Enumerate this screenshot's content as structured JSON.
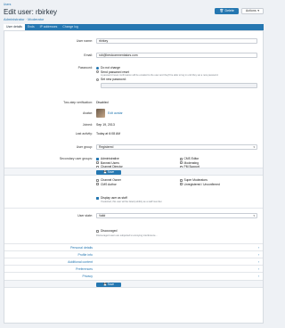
{
  "breadcrumb": "Users",
  "page_title": "Edit user: rbirkey",
  "subtitle": {
    "admin": "Administrator",
    "separator": "·",
    "mod": "Moderator"
  },
  "top_actions": {
    "delete": "Delete",
    "actions": "Actions"
  },
  "tabs": [
    {
      "label": "User details",
      "active": true
    },
    {
      "label": "Ends"
    },
    {
      "label": "IP addresses"
    },
    {
      "label": "Change log"
    }
  ],
  "fields": {
    "username": {
      "label": "User name:",
      "value": "rbirkey"
    },
    "email": {
      "label": "Email:",
      "value": "rob@bestcommentators.com"
    },
    "password": {
      "label": "Password:",
      "options": [
        {
          "label": "Do not change",
          "selected": true
        },
        {
          "label": "Send password reset",
          "hint": "A password reset confirmation will be emailed to the user and they'll be able to log in until they set a new password."
        },
        {
          "label": "Set new password:"
        }
      ]
    },
    "two_step": {
      "label": "Two-step verification:",
      "value": "Disabled"
    },
    "avatar": {
      "label": "Avatar:",
      "link": "Edit avatar"
    },
    "joined": {
      "label": "Joined:",
      "value": "Sep 19, 2013"
    },
    "last_activity": {
      "label": "Last activity:",
      "value": "Today at 6:08 AM"
    },
    "user_group": {
      "label": "User group:",
      "value": "Registered"
    },
    "secondary_groups": {
      "label": "Secondary user groups:",
      "col1": [
        {
          "label": "Administrative",
          "checked": true
        },
        {
          "label": "Banned Users"
        },
        {
          "label": "Channel Director"
        },
        {
          "label": "Channel Owner"
        },
        {
          "label": "CMS Author"
        }
      ],
      "col2": [
        {
          "label": "CMS Editor"
        },
        {
          "label": "Moderating"
        },
        {
          "label": "PM Support"
        },
        {
          "label": "Super Moderators"
        },
        {
          "label": "Unregistered / Unconfirmed"
        }
      ]
    },
    "display_staff": {
      "label": "Display user as staff",
      "hint": "If selected, this user will be listed publicly as a staff member.",
      "checked": true
    },
    "user_state": {
      "label": "User state:",
      "value": "Valid"
    },
    "discouraged": {
      "label": "Discouraged",
      "hint": "Discouraged users are subjected to annoying interference..."
    }
  },
  "save_label": "Save",
  "sections": [
    "Personal details",
    "Profile info",
    "Additional content",
    "Preferences",
    "Privacy"
  ],
  "colors": {
    "accent": "#2577b1",
    "panel": "#ffffff",
    "bg": "#eef1f5"
  }
}
